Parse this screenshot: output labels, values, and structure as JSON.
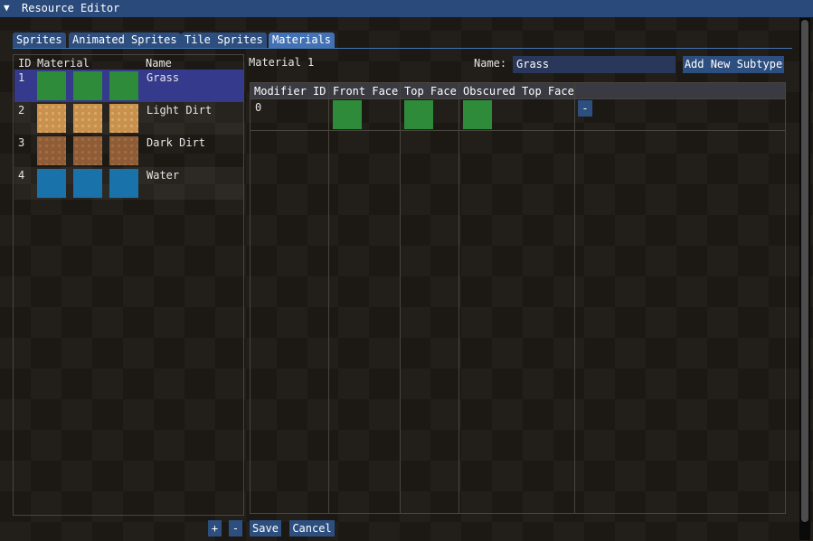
{
  "window": {
    "title": "Resource Editor",
    "collapse_icon": "triangle-down-icon"
  },
  "tabs": [
    {
      "label": "Sprites",
      "active": false
    },
    {
      "label": "Animated Sprites",
      "active": false
    },
    {
      "label": "Tile Sprites",
      "active": false
    },
    {
      "label": "Materials",
      "active": true
    }
  ],
  "material_list": {
    "headers": {
      "id": "ID",
      "material": "Material",
      "name": "Name"
    },
    "rows": [
      {
        "id": "1",
        "name": "Grass",
        "texture": "grass",
        "selected": true
      },
      {
        "id": "2",
        "name": "Light Dirt",
        "texture": "light-dirt",
        "selected": false
      },
      {
        "id": "3",
        "name": "Dark Dirt",
        "texture": "dark-dirt",
        "selected": false
      },
      {
        "id": "4",
        "name": "Water",
        "texture": "water",
        "selected": false
      }
    ]
  },
  "detail": {
    "material_label": "Material 1",
    "name_label": "Name:",
    "name_value": "Grass",
    "add_button": "Add New Subtype",
    "columns": [
      "Modifier ID",
      "Front Face",
      "Top Face",
      "Obscured Top Face"
    ],
    "rows": [
      {
        "modifier_id": "0",
        "remove": "-"
      }
    ]
  },
  "footer": {
    "add": "+",
    "remove": "-",
    "save": "Save",
    "cancel": "Cancel"
  },
  "colors": {
    "accent": "#4272b4",
    "selected_row": "#363a8c",
    "grass": "#2e8b3a",
    "water": "#1a72ab",
    "light_dirt": "#c8914d",
    "dark_dirt": "#8e5d37"
  }
}
